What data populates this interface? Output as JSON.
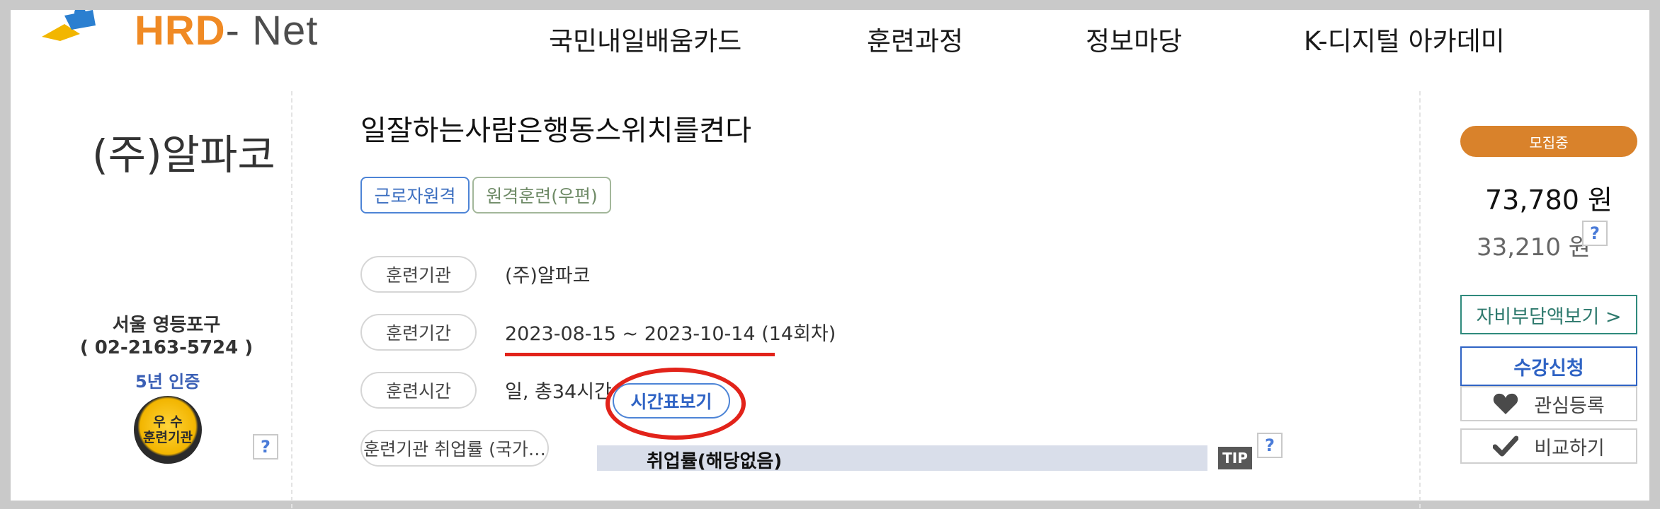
{
  "header": {
    "logo": {
      "brand_text": "HRD",
      "brand_suffix": "- Net",
      "accent_color": "#f08a24"
    },
    "nav": [
      "국민내일배움카드",
      "훈련과정",
      "정보마당",
      "K-디지털 아카데미"
    ]
  },
  "institution": {
    "name": "(주)알파코",
    "address": "서울 영등포구",
    "phone": "( 02-2163-5724 )",
    "certification": "5년 인증",
    "badge_text": [
      "우 수",
      "훈련기관"
    ]
  },
  "course": {
    "title": "일잘하는사람은행동스위치를켠다",
    "tags": [
      "근로자원격",
      "원격훈련(우편)"
    ],
    "details": [
      {
        "label": "훈련기관",
        "value": "(주)알파코"
      },
      {
        "label": "훈련기간",
        "value": "2023-08-15 ~ 2023-10-14 (14회차)"
      },
      {
        "label": "훈련시간",
        "value": "일, 총34시간"
      },
      {
        "label": "훈련기관 취업률 (국가…",
        "value": "취업률(해당없음)"
      }
    ],
    "timetable_button": "시간표보기",
    "tip_label": "TIP",
    "help_label": "?"
  },
  "sidebar": {
    "status": "모집중",
    "price": "73,780 원",
    "self_price": "33,210 원",
    "buttons": {
      "self_pay": "자비부담액보기 >",
      "apply": "수강신청",
      "interest": "관심등록",
      "compare": "비교하기"
    }
  },
  "colors": {
    "highlight": "#e2231a",
    "primary_blue": "#2f63c4",
    "status_orange": "#d9822b",
    "teal": "#2f7a6e"
  }
}
